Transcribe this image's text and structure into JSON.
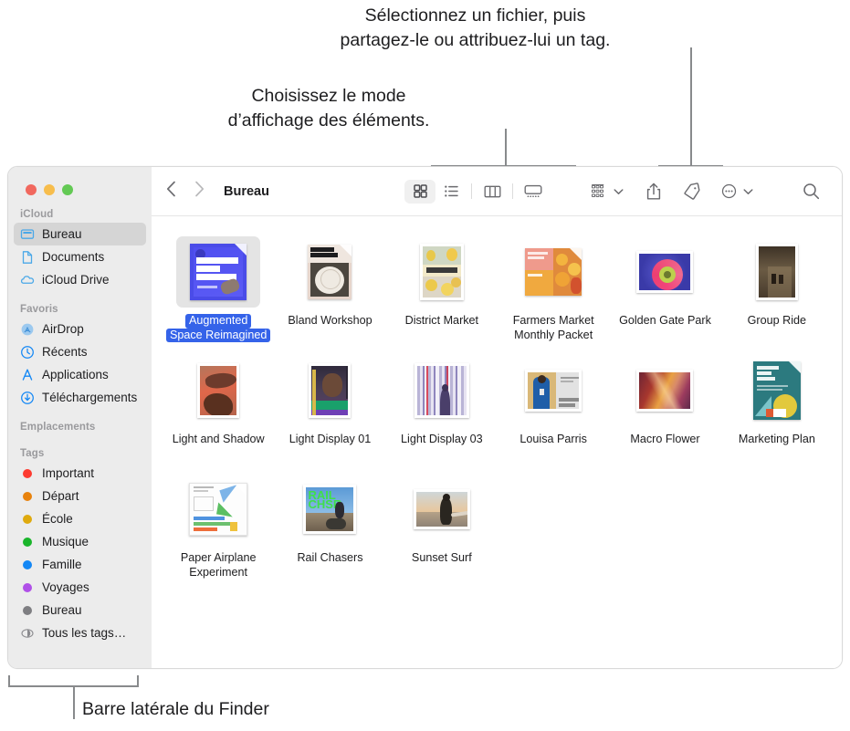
{
  "callouts": {
    "share": "Sélectionnez un fichier, puis\npartagez-le ou attribuez-lui un tag.",
    "view": "Choisissez le mode\nd’affichage des éléments.",
    "sidebar": "Barre latérale du Finder"
  },
  "window": {
    "traffic_lights": [
      {
        "name": "close",
        "color": "#f1685e"
      },
      {
        "name": "minimize",
        "color": "#f7bd4c"
      },
      {
        "name": "zoom",
        "color": "#63c954"
      }
    ]
  },
  "toolbar": {
    "back_label": "‹",
    "forward_label": "›",
    "title": "Bureau",
    "view_modes": [
      {
        "name": "icon-view",
        "label": "Présentation par icônes",
        "active": true
      },
      {
        "name": "list-view",
        "label": "Présentation par liste",
        "active": false
      },
      {
        "name": "column-view",
        "label": "Présentation par colonnes",
        "active": false
      },
      {
        "name": "gallery-view",
        "label": "Présentation par galerie",
        "active": false
      }
    ],
    "group_label": "Grouper",
    "share_label": "Partager",
    "tag_label": "Tags",
    "more_label": "Plus",
    "search_label": "Rechercher"
  },
  "sidebar": {
    "sections": [
      {
        "title": "iCloud",
        "items": [
          {
            "label": "Bureau",
            "icon": "desktop-icon",
            "selected": true
          },
          {
            "label": "Documents",
            "icon": "document-icon",
            "selected": false
          },
          {
            "label": "iCloud Drive",
            "icon": "cloud-icon",
            "selected": false
          }
        ]
      },
      {
        "title": "Favoris",
        "items": [
          {
            "label": "AirDrop",
            "icon": "airdrop-icon",
            "selected": false
          },
          {
            "label": "Récents",
            "icon": "clock-icon",
            "selected": false
          },
          {
            "label": "Applications",
            "icon": "applications-icon",
            "selected": false
          },
          {
            "label": "Téléchargements",
            "icon": "downloads-icon",
            "selected": false
          }
        ]
      },
      {
        "title": "Emplacements",
        "items": []
      },
      {
        "title": "Tags",
        "items": [
          {
            "label": "Important",
            "icon": "tag-dot",
            "color": "#fd3b30",
            "selected": false
          },
          {
            "label": "Départ",
            "icon": "tag-dot",
            "color": "#e8820c",
            "selected": false
          },
          {
            "label": "École",
            "icon": "tag-dot",
            "color": "#dfaa0e",
            "selected": false
          },
          {
            "label": "Musique",
            "icon": "tag-dot",
            "color": "#1ab52b",
            "selected": false
          },
          {
            "label": "Famille",
            "icon": "tag-dot",
            "color": "#1387f5",
            "selected": false
          },
          {
            "label": "Voyages",
            "icon": "tag-dot",
            "color": "#b050e8",
            "selected": false
          },
          {
            "label": "Bureau",
            "icon": "tag-dot",
            "color": "#7e7e82",
            "selected": false
          },
          {
            "label": "Tous les tags…",
            "icon": "all-tags-icon",
            "color": "",
            "selected": false
          }
        ]
      }
    ]
  },
  "files": [
    {
      "name": "Augmented Space Reimagined",
      "lines": [
        "Augmented",
        "Space Reimagined"
      ],
      "kind": "doc",
      "selected": true
    },
    {
      "name": "Bland Workshop",
      "lines": [
        "Bland Workshop"
      ],
      "kind": "doc",
      "selected": false
    },
    {
      "name": "District Market",
      "lines": [
        "District Market"
      ],
      "kind": "photo",
      "selected": false
    },
    {
      "name": "Farmers Market Monthly Packet",
      "lines": [
        "Farmers Market",
        "Monthly Packet"
      ],
      "kind": "doc",
      "selected": false
    },
    {
      "name": "Golden Gate Park",
      "lines": [
        "Golden Gate Park"
      ],
      "kind": "photo",
      "selected": false
    },
    {
      "name": "Group Ride",
      "lines": [
        "Group Ride"
      ],
      "kind": "photo",
      "selected": false
    },
    {
      "name": "Light and Shadow",
      "lines": [
        "Light and Shadow"
      ],
      "kind": "photo",
      "selected": false
    },
    {
      "name": "Light Display 01",
      "lines": [
        "Light Display 01"
      ],
      "kind": "photo",
      "selected": false
    },
    {
      "name": "Light Display 03",
      "lines": [
        "Light Display 03"
      ],
      "kind": "photo",
      "selected": false
    },
    {
      "name": "Louisa Parris",
      "lines": [
        "Louisa Parris"
      ],
      "kind": "photo",
      "selected": false
    },
    {
      "name": "Macro Flower",
      "lines": [
        "Macro Flower"
      ],
      "kind": "photo",
      "selected": false
    },
    {
      "name": "Marketing Plan",
      "lines": [
        "Marketing Plan"
      ],
      "kind": "doc",
      "selected": false
    },
    {
      "name": "Paper Airplane Experiment",
      "lines": [
        "Paper Airplane",
        "Experiment"
      ],
      "kind": "doc",
      "selected": false
    },
    {
      "name": "Rail Chasers",
      "lines": [
        "Rail Chasers"
      ],
      "kind": "photo",
      "selected": false
    },
    {
      "name": "Sunset Surf",
      "lines": [
        "Sunset Surf"
      ],
      "kind": "photo",
      "selected": false
    }
  ]
}
